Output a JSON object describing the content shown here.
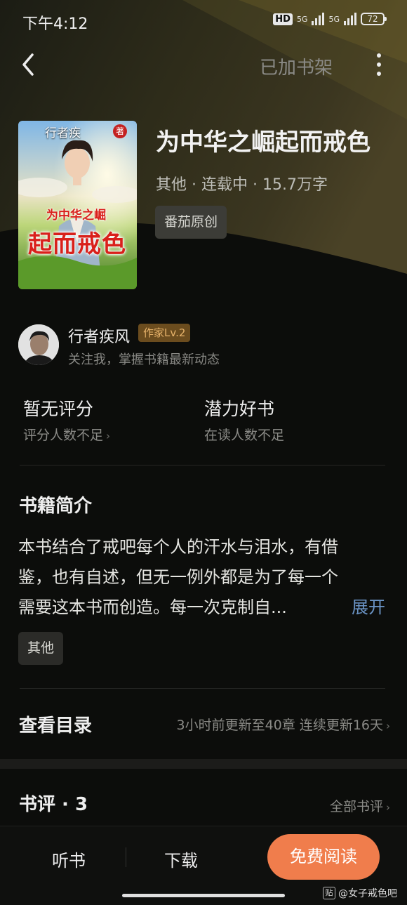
{
  "status_bar": {
    "time": "下午4:12",
    "hd_label": "HD",
    "network_1": "5G",
    "network_2": "5G",
    "battery": "72"
  },
  "nav": {
    "back_icon": "chevron-left-icon",
    "shelf_label": "已加书架",
    "more_icon": "more-vertical-icon"
  },
  "book": {
    "cover_author": "行者疾",
    "cover_seal": "著",
    "cover_title_line1": "为中华之崛",
    "cover_title_line2": "起而戒色",
    "title": "为中华之崛起而戒色",
    "meta": "其他 · 连载中 · 15.7万字",
    "tag": "番茄原创"
  },
  "author": {
    "name": "行者疾风",
    "level": "作家Lv.2",
    "subtitle": "关注我，掌握书籍最新动态"
  },
  "stats": {
    "rating_title": "暂无评分",
    "rating_sub": "评分人数不足",
    "potential_title": "潜力好书",
    "potential_sub": "在读人数不足"
  },
  "intro": {
    "title": "书籍简介",
    "line1": "本书结合了戒吧每个人的汗水与泪水，有借",
    "line2": "鉴，也有自述，但无一例外都是为了每一个",
    "line3": "需要这本书而创造。每一次克制自...",
    "expand": "展开",
    "genre_tag": "其他"
  },
  "toc": {
    "title": "查看目录",
    "info": "3小时前更新至40章 连续更新16天"
  },
  "reviews": {
    "title": "书评 · 3",
    "all": "全部书评"
  },
  "bottom": {
    "listen": "听书",
    "download": "下载",
    "read": "免费阅读"
  },
  "watermark": {
    "logo": "贴",
    "text": "@女子戒色吧"
  },
  "colors": {
    "background": "#0c0d0b",
    "accent": "#f07d4c",
    "link": "#6b94c6",
    "level_badge": "#e6b26a"
  }
}
